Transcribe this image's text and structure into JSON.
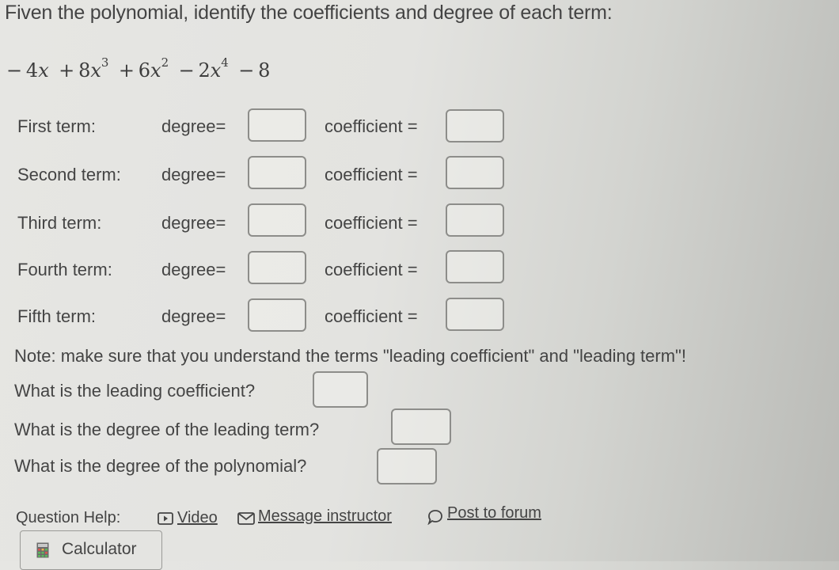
{
  "prompt": "Fiven the polynomial, identify the coefficients and degree of each term:",
  "polynomial": {
    "terms": [
      {
        "sign": "−",
        "coef": "4",
        "var": "x",
        "exp": ""
      },
      {
        "sign": "+",
        "coef": "8",
        "var": "x",
        "exp": "3"
      },
      {
        "sign": "+",
        "coef": "6",
        "var": "x",
        "exp": "2"
      },
      {
        "sign": "−",
        "coef": "2",
        "var": "x",
        "exp": "4"
      },
      {
        "sign": "−",
        "coef": "8",
        "var": "",
        "exp": ""
      }
    ]
  },
  "rows": [
    {
      "label": "First term:",
      "degree_label": "degree=",
      "coefficient_label": "coefficient =",
      "degree_value": "",
      "coefficient_value": ""
    },
    {
      "label": "Second term:",
      "degree_label": "degree=",
      "coefficient_label": "coefficient =",
      "degree_value": "",
      "coefficient_value": ""
    },
    {
      "label": "Third term:",
      "degree_label": "degree=",
      "coefficient_label": "coefficient =",
      "degree_value": "",
      "coefficient_value": ""
    },
    {
      "label": "Fourth term:",
      "degree_label": "degree=",
      "coefficient_label": "coefficient =",
      "degree_value": "",
      "coefficient_value": ""
    },
    {
      "label": "Fifth term:",
      "degree_label": "degree=",
      "coefficient_label": "coefficient =",
      "degree_value": "",
      "coefficient_value": ""
    }
  ],
  "note": "Note: make sure that you understand the terms \"leading coefficient\" and \"leading term\"!",
  "questions": [
    {
      "text": "What is the leading coefficient?",
      "value": ""
    },
    {
      "text": "What is the degree of the leading term?",
      "value": ""
    },
    {
      "text": "What is the degree of the polynomial?",
      "value": ""
    }
  ],
  "help": {
    "label": "Question Help:",
    "video": {
      "label": "Video",
      "icon": "video-icon"
    },
    "message": {
      "label": "Message instructor",
      "icon": "mail-icon"
    },
    "forum": {
      "label": "Post to forum",
      "icon": "speech-bubble-icon"
    }
  },
  "calculator": {
    "label": "Calculator",
    "icon": "calculator-icon"
  }
}
